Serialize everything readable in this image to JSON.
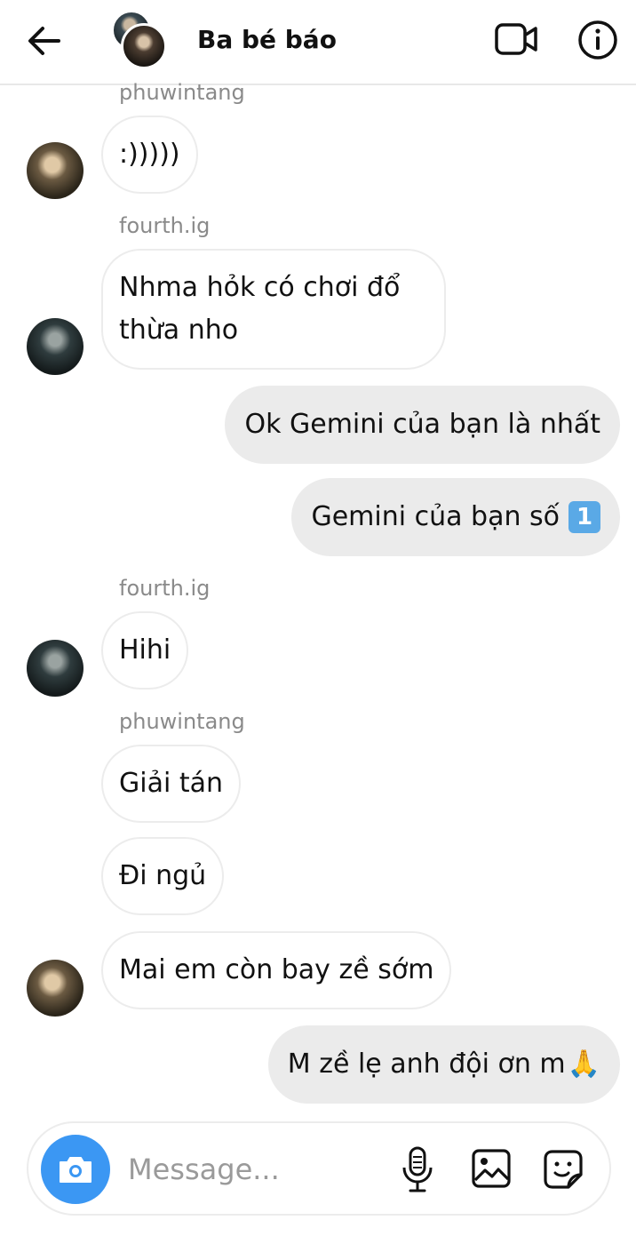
{
  "header": {
    "title": "Ba bé báo"
  },
  "messages": {
    "m1": {
      "sender": "phuwintang",
      "text": ":)))))"
    },
    "m2": {
      "sender": "fourth.ig",
      "line1": "Nhma hỏk có chơi đổ",
      "line2": "thừa nho"
    },
    "m3": {
      "text": "Ok Gemini của bạn là nhất"
    },
    "m4": {
      "text": "Gemini của bạn số",
      "emoji": "1"
    },
    "m5": {
      "sender": "fourth.ig",
      "text": "Hihi"
    },
    "m6": {
      "sender": "phuwintang",
      "text": "Giải tán"
    },
    "m7": {
      "text": "Đi ngủ"
    },
    "m8": {
      "text": "Mai em còn bay zề sớm"
    },
    "m9": {
      "text": "M zề lẹ anh đội ơn m",
      "emoji": "🙏"
    }
  },
  "composer": {
    "placeholder": "Message..."
  },
  "icons": {
    "back": "arrow-left-icon",
    "video": "video-camera-icon",
    "info": "info-icon",
    "camera": "camera-icon",
    "mic": "microphone-icon",
    "gallery": "image-icon",
    "sticker": "sticker-icon"
  },
  "colors": {
    "accent": "#3b97f3",
    "incoming_bubble": "#ffffff",
    "outgoing_bubble": "#ebebeb",
    "sender_label": "#8a8a8a"
  }
}
